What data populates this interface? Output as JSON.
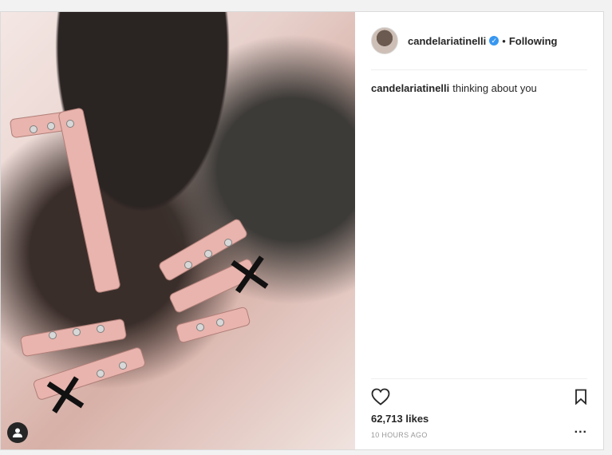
{
  "post": {
    "username": "candelariatinelli",
    "verified": true,
    "separator": "•",
    "follow_status": "Following",
    "caption": {
      "username": "candelariatinelli",
      "text": "thinking about you"
    },
    "likes": "62,713 likes",
    "timestamp": "10 HOURS AGO",
    "more_options": "..."
  },
  "icons": {
    "heart": "heart-icon",
    "bookmark": "bookmark-icon",
    "tagged_user": "person-tag-icon",
    "verified": "verified-badge-icon",
    "more": "ellipsis-icon"
  },
  "colors": {
    "verified_blue": "#3897f0",
    "text": "#262626",
    "muted": "#999999",
    "border": "#dbdbdb"
  }
}
